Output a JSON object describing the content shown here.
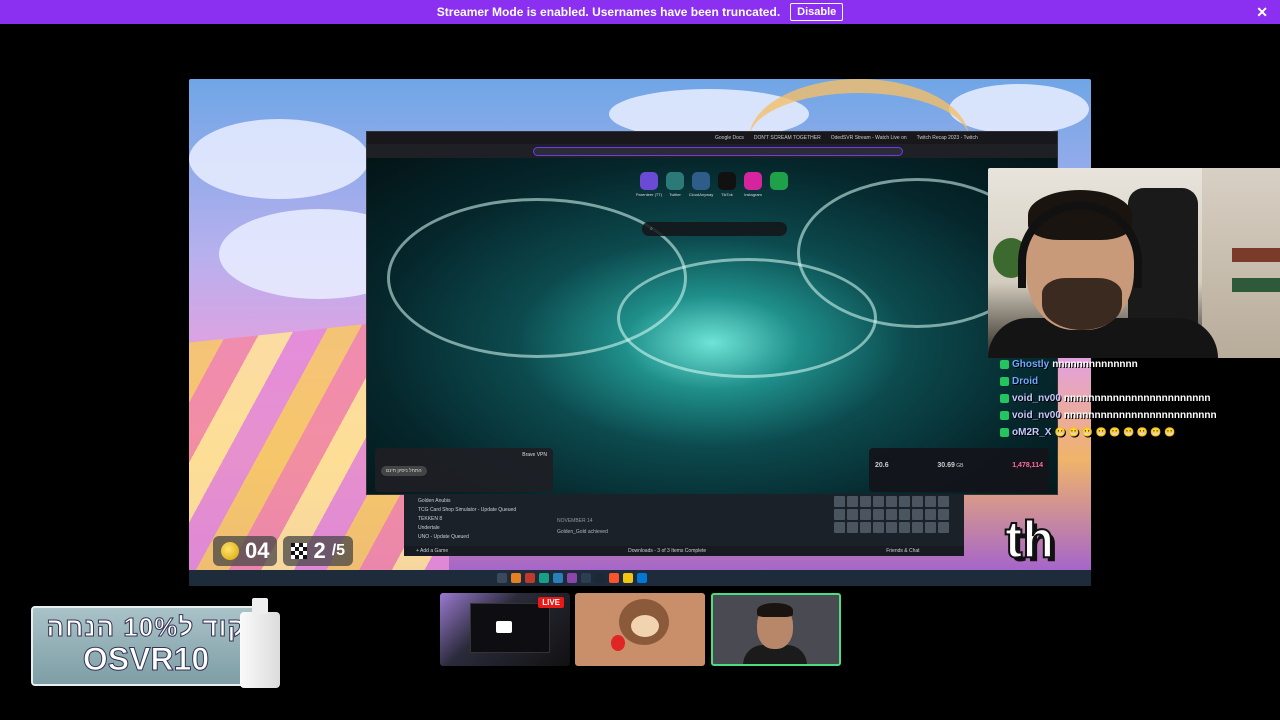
{
  "banner": {
    "text": "Streamer Mode is enabled. Usernames have been truncated.",
    "disable_label": "Disable",
    "close_icon": "close-icon"
  },
  "game_hud": {
    "coins": "04",
    "laps": "2",
    "laps_total": "/5",
    "logo_text": "th"
  },
  "browser": {
    "tabs": [
      "Google Docs",
      "DON'T SCREAM TOGETHER",
      "OdedSVR Stream - Watch Live on",
      "Twitch Recap 2023 - Twitch"
    ],
    "shortcuts": [
      {
        "label": "Parenteer (TT)",
        "color": "#6b4bd6"
      },
      {
        "label": "Twitter",
        "color": "#2b7a78"
      },
      {
        "label": "CloudAnyway",
        "color": "#2f5d8a"
      },
      {
        "label": "TikTok",
        "color": "#111111"
      },
      {
        "label": "Instagram",
        "color": "#d6249f"
      },
      {
        "label": "",
        "color": "#1fa14a"
      }
    ],
    "vpn": {
      "title": "Brave VPN",
      "button": "התחל ניסיון חינם"
    },
    "stats": {
      "v1": "20.6",
      "v2": "30.69",
      "v2_unit": "GB",
      "v3": "1,478,114"
    }
  },
  "steam": {
    "items": [
      "Golden Anubis",
      "TCG Card Shop Simulator - Update Queued",
      "TEKKEN 8",
      "Undertale",
      "UNO - Update Queued"
    ],
    "date": "NOVEMBER 14",
    "activity": "Golden_Gold achieved",
    "add_game": "+ Add a Game",
    "downloads": "Downloads - 3 of 3 Items Complete",
    "friends": "Friends & Chat"
  },
  "chat": {
    "lines": [
      {
        "name": "Ghostly",
        "msg": "nnnnnnnnnnnnnn",
        "name_color": "#6ea8ff"
      },
      {
        "name": "Droid",
        "msg": "",
        "name_color": "#6ea8ff"
      },
      {
        "name": "void_nv00",
        "msg": "nnnnnnnnnnnnnnnnnnnnnnnn",
        "name_color": "#c7c7ff"
      },
      {
        "name": "void_nv00",
        "msg": "nnnnnnnnnnnnnnnnnnnnnnnnn",
        "name_color": "#c7c7ff"
      },
      {
        "name": "oM2R_X",
        "msg": "😬 😬 😬 😬 😬 😬 😬 😬 😬",
        "name_color": "#c7c7ff"
      }
    ]
  },
  "promo": {
    "line1": "קוד ל10% הנחה",
    "line2": "OSVR10"
  },
  "thumbnails": {
    "live_label": "LIVE"
  },
  "colors": {
    "banner_bg": "#8b2ff0",
    "live_red": "#e91916",
    "selected_border": "#4ade80"
  }
}
